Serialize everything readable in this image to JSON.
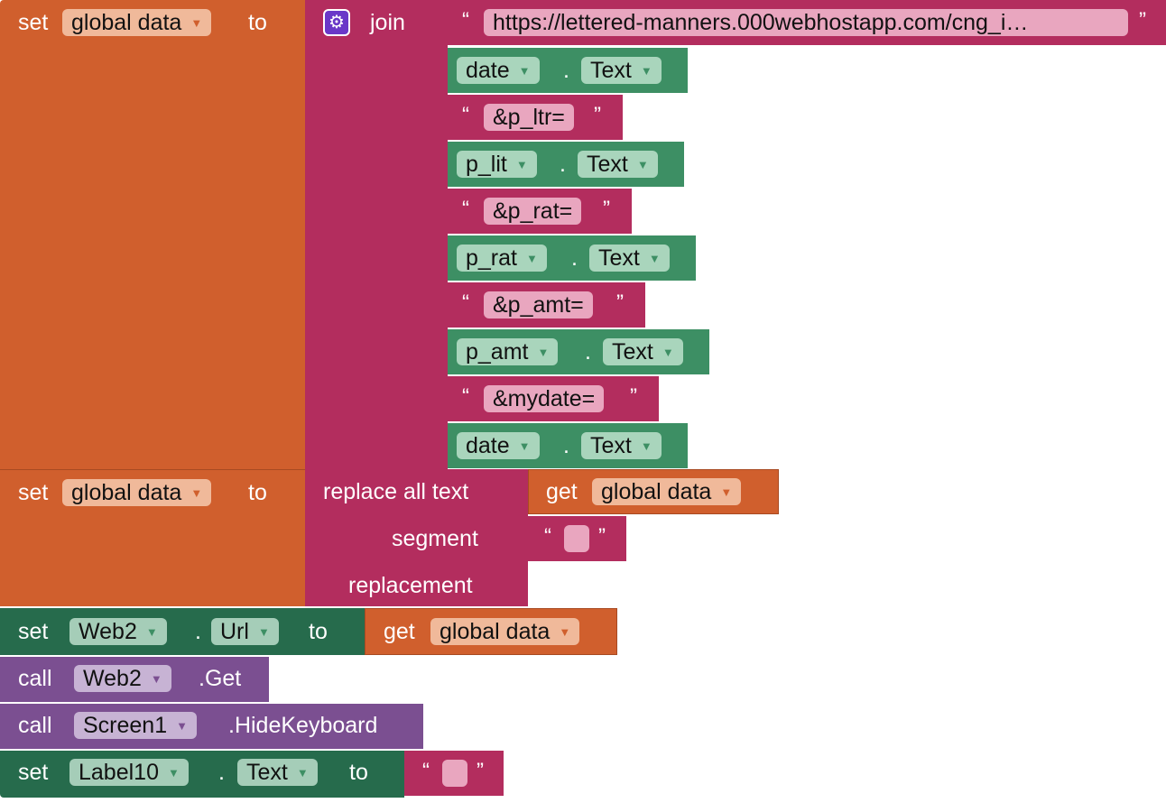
{
  "block1": {
    "set": "set",
    "var": "global data",
    "to": "to",
    "join": "join",
    "url": "https://lettered-manners.000webhostapp.com/cng_i…",
    "items": [
      {
        "comp": "date",
        "prop": "Text"
      },
      {
        "text": "&p_ltr="
      },
      {
        "comp": "p_lit",
        "prop": "Text"
      },
      {
        "text": "&p_rat="
      },
      {
        "comp": "p_rat",
        "prop": "Text"
      },
      {
        "text": "&p_amt="
      },
      {
        "comp": "p_amt",
        "prop": "Text"
      },
      {
        "text": "&mydate="
      },
      {
        "comp": "date",
        "prop": "Text"
      }
    ],
    "dot": "."
  },
  "block2": {
    "set": "set",
    "var": "global data",
    "to": "to",
    "replace": "replace all text",
    "segment": "segment",
    "replacement": "replacement",
    "get": "get",
    "get_var": "global data"
  },
  "block3": {
    "set": "set",
    "comp": "Web2",
    "dot": ".",
    "prop": "Url",
    "to": "to",
    "get": "get",
    "get_var": "global data"
  },
  "block4": {
    "call": "call",
    "comp": "Web2",
    "method": ".Get"
  },
  "block5": {
    "call": "call",
    "comp": "Screen1",
    "method": ".HideKeyboard"
  },
  "block6": {
    "set": "set",
    "comp": "Label10",
    "dot": ".",
    "prop": "Text",
    "to": "to"
  },
  "quote_open": "“",
  "quote_close": "”",
  "dropdown_arrow": "▼",
  "gear_glyph": "⚙",
  "colors": {
    "orange": "#d05f2d",
    "magenta": "#b32d5e",
    "green": "#3d8f64",
    "dark_green": "#266b4c",
    "purple": "#7b4f91",
    "mutator_gear": "#6a38c8"
  }
}
